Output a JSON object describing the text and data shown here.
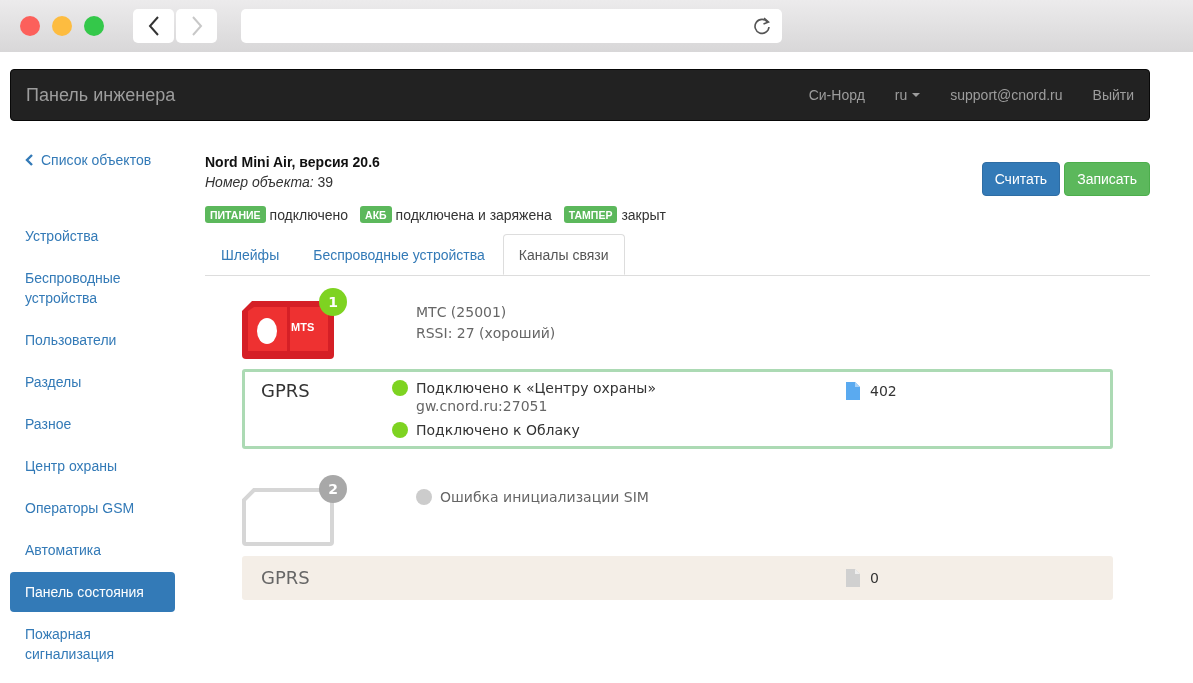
{
  "browser": {
    "back": {
      "disabled": false
    },
    "forward": {
      "disabled": true
    }
  },
  "navbar": {
    "brand": "Панель инженера",
    "items": [
      {
        "label": "Си-Норд",
        "kind": "link"
      },
      {
        "label": "ru",
        "kind": "dropdown"
      },
      {
        "label": "support@cnord.ru",
        "kind": "link"
      },
      {
        "label": "Выйти",
        "kind": "link"
      }
    ]
  },
  "sidebar": {
    "back_link": "Список объектов",
    "items": [
      {
        "label": "Устройства",
        "selected": false
      },
      {
        "label": "Беспроводные устройства",
        "selected": false
      },
      {
        "label": "Пользователи",
        "selected": false
      },
      {
        "label": "Разделы",
        "selected": false
      },
      {
        "label": "Разное",
        "selected": false
      },
      {
        "label": "Центр охраны",
        "selected": false
      },
      {
        "label": "Операторы GSM",
        "selected": false
      },
      {
        "label": "Автоматика",
        "selected": false
      },
      {
        "label": "Панель состояния",
        "selected": true
      },
      {
        "label": "Пожарная сигнализация",
        "selected": false
      }
    ]
  },
  "device": {
    "title": "Nord Mini Air, версия 20.6",
    "object": "*Номер объекта:* 39"
  },
  "buttons": [
    {
      "label": "Считать",
      "kind": "primary"
    },
    {
      "label": "Записать",
      "kind": "success"
    }
  ],
  "statuses": [
    {
      "badge": "ПИТАНИЕ",
      "text": "подключено"
    },
    {
      "badge": "АКБ",
      "text": "подключена и заряжена"
    },
    {
      "badge": "ТАМПЕР",
      "text": "закрыт"
    }
  ],
  "tabs": [
    {
      "label": "Шлейфы",
      "selected": false
    },
    {
      "label": "Беспроводные устройства",
      "selected": false
    },
    {
      "label": "Каналы связи",
      "selected": true
    }
  ],
  "sims": [
    {
      "number": "1",
      "active": true,
      "logo_text": "MTS",
      "info": [
        "МТС (25001)",
        "RSSI: 27 (хороший)"
      ],
      "channel": {
        "name": "GPRS",
        "active": true,
        "connections": [
          {
            "text": "Подключено к «Центру охраны»",
            "detail": "gw.cnord.ru:27051",
            "color": "#7ed321"
          },
          {
            "text": "Подключено к Облаку",
            "color": "#7ed321"
          }
        ],
        "count": "402"
      }
    },
    {
      "number": "2",
      "active": false,
      "status": {
        "text": "Ошибка инициализации SIM",
        "color": "#cccccc"
      },
      "channel": {
        "name": "GPRS",
        "active": false,
        "count": "0"
      }
    }
  ]
}
